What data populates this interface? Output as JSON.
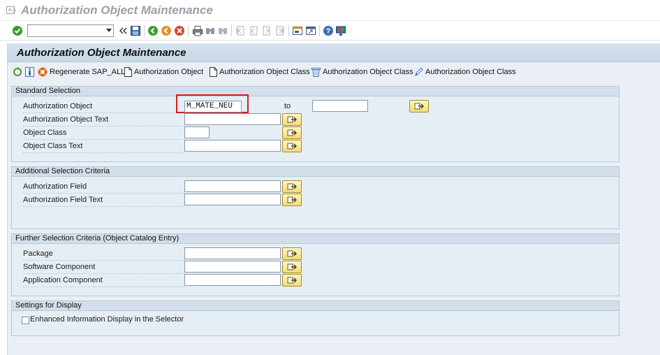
{
  "window": {
    "title": "Authorization Object Maintenance"
  },
  "system_toolbar": {
    "command_field_value": "",
    "icons": [
      "enter-icon",
      "back-icon",
      "save-icon",
      "back-green-icon",
      "exit-icon",
      "cancel-icon",
      "print-icon",
      "find-icon",
      "find-next-icon",
      "first-page-icon",
      "previous-page-icon",
      "next-page-icon",
      "last-page-icon",
      "new-session-icon",
      "shortcut-icon",
      "help-icon",
      "customize-layout-icon"
    ]
  },
  "screen": {
    "title": "Authorization Object Maintenance"
  },
  "app_toolbar": {
    "regenerate_label": "Regenerate SAP_ALL",
    "create_object_label": "Authorization Object",
    "create_class_label": "Authorization Object Class",
    "delete_class_label": "Authorization Object Class",
    "change_class_label": "Authorization Object Class"
  },
  "standard_selection": {
    "title": "Standard Selection",
    "auth_object_label": "Authorization Object",
    "auth_object_from": "M_MATE_NEU",
    "to_label": "to",
    "auth_object_to": "",
    "auth_object_text_label": "Authorization Object Text",
    "auth_object_text_value": "",
    "object_class_label": "Object Class",
    "object_class_value": "",
    "object_class_text_label": "Object Class Text",
    "object_class_text_value": ""
  },
  "additional_selection": {
    "title": "Additional Selection Criteria",
    "auth_field_label": "Authorization Field",
    "auth_field_value": "",
    "auth_field_text_label": "Authorization Field Text",
    "auth_field_text_value": ""
  },
  "further_selection": {
    "title": "Further Selection Criteria (Object Catalog Entry)",
    "package_label": "Package",
    "package_value": "",
    "software_component_label": "Software Component",
    "software_component_value": "",
    "application_component_label": "Application Component",
    "application_component_value": ""
  },
  "display_settings": {
    "title": "Settings for Display",
    "enhanced_display_label": "Enhanced Information Display in the Selector",
    "enhanced_display_checked": false
  },
  "colors": {
    "highlight": "#d41d1d",
    "header_bg": "#c6d5e4",
    "group_bg": "#e6eef5"
  }
}
